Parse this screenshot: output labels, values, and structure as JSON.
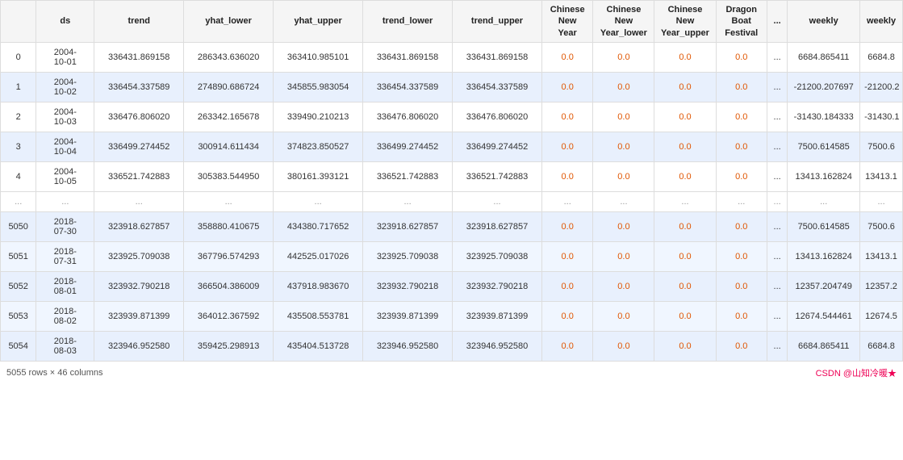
{
  "table": {
    "columns": [
      {
        "key": "idx",
        "label": "",
        "class": "col-idx"
      },
      {
        "key": "ds",
        "label": "ds",
        "class": "col-ds"
      },
      {
        "key": "trend",
        "label": "trend",
        "class": "col-trend"
      },
      {
        "key": "yhat_lower",
        "label": "yhat_lower",
        "class": "col-yhat_lower"
      },
      {
        "key": "yhat_upper",
        "label": "yhat_upper",
        "class": "col-yhat_upper"
      },
      {
        "key": "trend_lower",
        "label": "trend_lower",
        "class": "col-trend_lower"
      },
      {
        "key": "trend_upper",
        "label": "trend_upper",
        "class": "col-trend_upper"
      },
      {
        "key": "cny",
        "label": "Chinese New Year",
        "class": "col-cny"
      },
      {
        "key": "cny_lower",
        "label": "Chinese New Year_lower",
        "class": "col-cny_lower"
      },
      {
        "key": "cny_upper",
        "label": "Chinese New Year_upper",
        "class": "col-cny_upper"
      },
      {
        "key": "dragon",
        "label": "Dragon Boat Festival",
        "class": "col-dragon"
      },
      {
        "key": "dots",
        "label": "...",
        "class": "col-dots"
      },
      {
        "key": "weekly1",
        "label": "weekly",
        "class": "col-weekly1"
      },
      {
        "key": "weekly2",
        "label": "weekly",
        "class": "col-weekly2"
      }
    ],
    "rows": [
      {
        "idx": "0",
        "ds": "2004-10-01",
        "trend": "336431.869158",
        "yhat_lower": "286343.636020",
        "yhat_upper": "363410.985101",
        "trend_lower": "336431.869158",
        "trend_upper": "336431.869158",
        "cny": "0.0",
        "cny_lower": "0.0",
        "cny_upper": "0.0",
        "dragon": "0.0",
        "dots": "...",
        "weekly1": "6684.865411",
        "weekly2": "6684.8",
        "type": "normal"
      },
      {
        "idx": "1",
        "ds": "2004-10-02",
        "trend": "336454.337589",
        "yhat_lower": "274890.686724",
        "yhat_upper": "345855.983054",
        "trend_lower": "336454.337589",
        "trend_upper": "336454.337589",
        "cny": "0.0",
        "cny_lower": "0.0",
        "cny_upper": "0.0",
        "dragon": "0.0",
        "dots": "...",
        "weekly1": "-21200.207697",
        "weekly2": "-21200.2",
        "type": "alt"
      },
      {
        "idx": "2",
        "ds": "2004-10-03",
        "trend": "336476.806020",
        "yhat_lower": "263342.165678",
        "yhat_upper": "339490.210213",
        "trend_lower": "336476.806020",
        "trend_upper": "336476.806020",
        "cny": "0.0",
        "cny_lower": "0.0",
        "cny_upper": "0.0",
        "dragon": "0.0",
        "dots": "...",
        "weekly1": "-31430.184333",
        "weekly2": "-31430.1",
        "type": "normal"
      },
      {
        "idx": "3",
        "ds": "2004-10-04",
        "trend": "336499.274452",
        "yhat_lower": "300914.611434",
        "yhat_upper": "374823.850527",
        "trend_lower": "336499.274452",
        "trend_upper": "336499.274452",
        "cny": "0.0",
        "cny_lower": "0.0",
        "cny_upper": "0.0",
        "dragon": "0.0",
        "dots": "...",
        "weekly1": "7500.614585",
        "weekly2": "7500.6",
        "type": "alt"
      },
      {
        "idx": "4",
        "ds": "2004-10-05",
        "trend": "336521.742883",
        "yhat_lower": "305383.544950",
        "yhat_upper": "380161.393121",
        "trend_lower": "336521.742883",
        "trend_upper": "336521.742883",
        "cny": "0.0",
        "cny_lower": "0.0",
        "cny_upper": "0.0",
        "dragon": "0.0",
        "dots": "...",
        "weekly1": "13413.162824",
        "weekly2": "13413.1",
        "type": "normal"
      },
      {
        "idx": "...",
        "ds": "...",
        "trend": "...",
        "yhat_lower": "...",
        "yhat_upper": "...",
        "trend_lower": "...",
        "trend_upper": "...",
        "cny": "...",
        "cny_lower": "...",
        "cny_upper": "...",
        "dragon": "...",
        "dots": "...",
        "weekly1": "...",
        "weekly2": "...",
        "type": "ellipsis"
      },
      {
        "idx": "5050",
        "ds": "2018-07-30",
        "trend": "323918.627857",
        "yhat_lower": "358880.410675",
        "yhat_upper": "434380.717652",
        "trend_lower": "323918.627857",
        "trend_upper": "323918.627857",
        "cny": "0.0",
        "cny_lower": "0.0",
        "cny_upper": "0.0",
        "dragon": "0.0",
        "dots": "...",
        "weekly1": "7500.614585",
        "weekly2": "7500.6",
        "type": "alt"
      },
      {
        "idx": "5051",
        "ds": "2018-07-31",
        "trend": "323925.709038",
        "yhat_lower": "367796.574293",
        "yhat_upper": "442525.017026",
        "trend_lower": "323925.709038",
        "trend_upper": "323925.709038",
        "cny": "0.0",
        "cny_lower": "0.0",
        "cny_upper": "0.0",
        "dragon": "0.0",
        "dots": "...",
        "weekly1": "13413.162824",
        "weekly2": "13413.1",
        "type": "normal"
      },
      {
        "idx": "5052",
        "ds": "2018-08-01",
        "trend": "323932.790218",
        "yhat_lower": "366504.386009",
        "yhat_upper": "437918.983670",
        "trend_lower": "323932.790218",
        "trend_upper": "323932.790218",
        "cny": "0.0",
        "cny_lower": "0.0",
        "cny_upper": "0.0",
        "dragon": "0.0",
        "dots": "...",
        "weekly1": "12357.204749",
        "weekly2": "12357.2",
        "type": "alt"
      },
      {
        "idx": "5053",
        "ds": "2018-08-02",
        "trend": "323939.871399",
        "yhat_lower": "364012.367592",
        "yhat_upper": "435508.553781",
        "trend_lower": "323939.871399",
        "trend_upper": "323939.871399",
        "cny": "0.0",
        "cny_lower": "0.0",
        "cny_upper": "0.0",
        "dragon": "0.0",
        "dots": "...",
        "weekly1": "12674.544461",
        "weekly2": "12674.5",
        "type": "normal"
      },
      {
        "idx": "5054",
        "ds": "2018-08-03",
        "trend": "323946.952580",
        "yhat_lower": "359425.298913",
        "yhat_upper": "435404.513728",
        "trend_lower": "323946.952580",
        "trend_upper": "323946.952580",
        "cny": "0.0",
        "cny_lower": "0.0",
        "cny_upper": "0.0",
        "dragon": "0.0",
        "dots": "...",
        "weekly1": "6684.865411",
        "weekly2": "6684.8",
        "type": "alt"
      }
    ],
    "footer_left": "5055 rows × 46 columns",
    "footer_right": "CSDN @山知冷暖★"
  }
}
